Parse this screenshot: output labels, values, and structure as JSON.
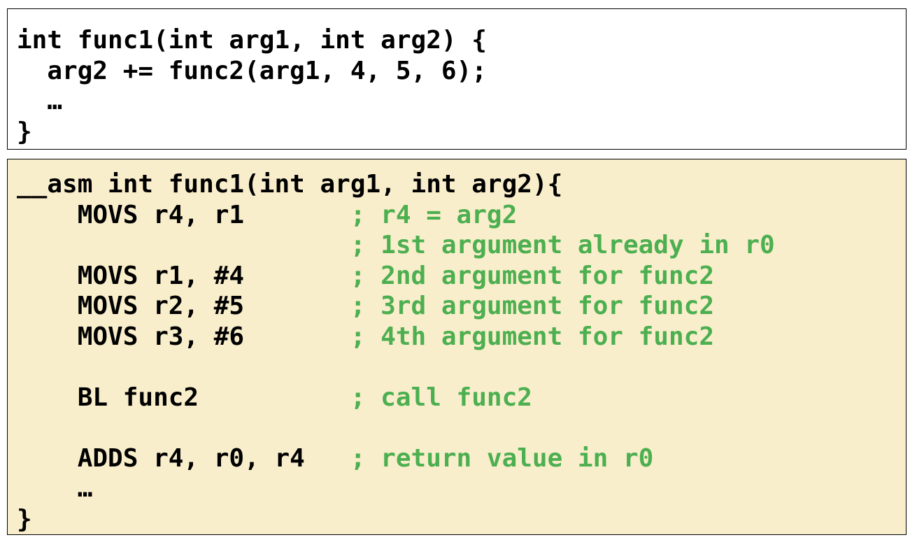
{
  "c_code": {
    "lines": [
      "int func1(int arg1, int arg2) {",
      "  arg2 += func2(arg1, 4, 5, 6);",
      "  …",
      "}"
    ]
  },
  "asm_code": {
    "lines": [
      {
        "code": "__asm int func1(int arg1, int arg2){",
        "comment": ""
      },
      {
        "code": "    MOVS r4, r1       ",
        "comment": "; r4 = arg2"
      },
      {
        "code": "                      ",
        "comment": "; 1st argument already in r0"
      },
      {
        "code": "    MOVS r1, #4       ",
        "comment": "; 2nd argument for func2"
      },
      {
        "code": "    MOVS r2, #5       ",
        "comment": "; 3rd argument for func2"
      },
      {
        "code": "    MOVS r3, #6       ",
        "comment": "; 4th argument for func2"
      },
      {
        "code": "",
        "comment": ""
      },
      {
        "code": "    BL func2          ",
        "comment": "; call func2"
      },
      {
        "code": "",
        "comment": ""
      },
      {
        "code": "    ADDS r4, r0, r4   ",
        "comment": "; return value in r0"
      },
      {
        "code": "    …",
        "comment": ""
      },
      {
        "code": "}",
        "comment": ""
      }
    ]
  },
  "colors": {
    "asm_background": "#f9eecb",
    "comment": "#4caf50",
    "border": "#000000"
  }
}
